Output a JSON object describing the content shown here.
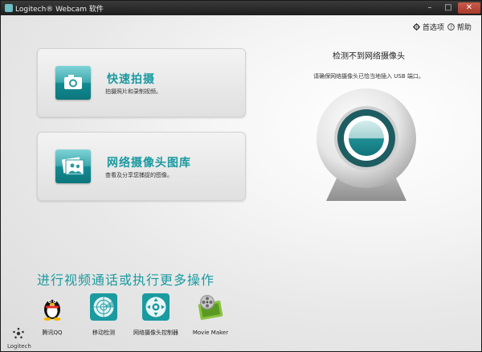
{
  "window": {
    "title": "Logitech® Webcam 软件",
    "minimize": "–",
    "maximize": "□",
    "close": "✕"
  },
  "topbar": {
    "settings_label": "首选项",
    "settings_icon": "gear-icon",
    "help_label": "帮助",
    "help_icon": "help-circle-icon"
  },
  "cards": [
    {
      "title": "快速拍摄",
      "subtitle": "拍摄照片和录制视频。",
      "icon": "camera-icon"
    },
    {
      "title": "网络摄像头图库",
      "subtitle": "查看及分享您捕捉的图像。",
      "icon": "photo-gallery-icon"
    }
  ],
  "status": {
    "title": "检测不到网络摄像头",
    "subtitle": "请确保网络摄像头已恰当地插入 USB 端口。"
  },
  "bottom": {
    "heading": "进行视频通话或执行更多操作",
    "tools": [
      {
        "label": "腾讯QQ",
        "icon": "qq-penguin-icon"
      },
      {
        "label": "移动检测",
        "icon": "motion-radar-icon"
      },
      {
        "label": "网络摄像头控制器",
        "icon": "camera-controller-icon"
      },
      {
        "label": "Movie Maker",
        "icon": "film-reel-icon"
      }
    ]
  },
  "brand": {
    "logo_text": "Logitech"
  },
  "colors": {
    "accent": "#1a9aa0",
    "titlebar": "#262626",
    "close": "#b84533"
  }
}
